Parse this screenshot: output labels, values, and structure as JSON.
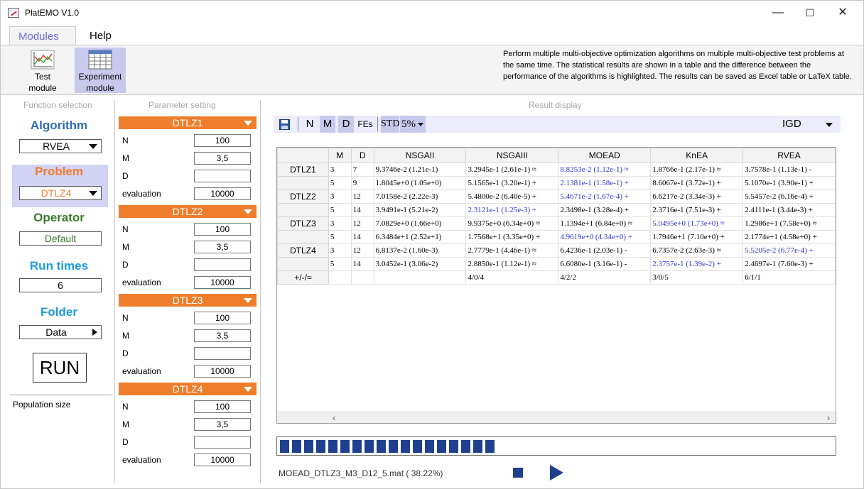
{
  "window": {
    "title": "PlatEMO V1.0",
    "minimize": "—",
    "maximize": "☐",
    "close": "✕"
  },
  "menu": {
    "modules": "Modules",
    "help": "Help"
  },
  "ribbon": {
    "test_module_line1": "Test",
    "test_module_line2": "module",
    "experiment_module_line1": "Experiment",
    "experiment_module_line2": "module",
    "description": "Perform multiple multi-objective optimization algorithms on multiple multi-objective test problems at the same time. The statistical results are shown in a table and the difference between the performance of the algorithms is highlighted. The results can be saved as Excel table or LaTeX table."
  },
  "sections": {
    "function_selection": "Function selection",
    "parameter_setting": "Parameter setting",
    "result_display": "Result display"
  },
  "left": {
    "algorithm_label": "Algorithm",
    "algorithm_value": "RVEA",
    "problem_label": "Problem",
    "problem_value": "DTLZ4",
    "operator_label": "Operator",
    "operator_value": "Default",
    "run_times_label": "Run times",
    "run_times_value": "6",
    "folder_label": "Folder",
    "folder_value": "Data",
    "run_button": "RUN",
    "help_text": "Population size",
    "colors": {
      "algorithm": "#2e6db3",
      "problem": "#ee7d2c",
      "operator": "#3d7a2e",
      "run_times": "#1a9be0",
      "folder": "#1a9be0",
      "highlight": "#d3d3f5"
    }
  },
  "parameters": [
    {
      "problem": "DTLZ1",
      "N": "100",
      "M": "3,5",
      "D": "",
      "evaluation": "10000"
    },
    {
      "problem": "DTLZ2",
      "N": "100",
      "M": "3,5",
      "D": "",
      "evaluation": "10000"
    },
    {
      "problem": "DTLZ3",
      "N": "100",
      "M": "3,5",
      "D": "",
      "evaluation": "10000"
    },
    {
      "problem": "DTLZ4",
      "N": "100",
      "M": "3,5",
      "D": "",
      "evaluation": "10000"
    }
  ],
  "param_labels": {
    "N": "N",
    "M": "M",
    "D": "D",
    "evaluation": "evaluation"
  },
  "toolbar": {
    "save_icon": "save-icon",
    "N": "N",
    "M": "M",
    "D": "D",
    "FEs": "FEs",
    "STD": "STD",
    "significance": "5%",
    "metric": "IGD"
  },
  "table": {
    "headers": [
      "",
      "M",
      "D",
      "NSGAII",
      "NSGAIII",
      "MOEAD",
      "KnEA",
      "RVEA"
    ],
    "rows": [
      {
        "problem": "DTLZ1",
        "M": "3",
        "D": "7",
        "cells": [
          {
            "t": "9.3746e-2 (1.21e-1)",
            "blue": false
          },
          {
            "t": "3.2945e-1 (2.61e-1) ≈",
            "blue": false
          },
          {
            "t": "8.8253e-2 (1.12e-1) ≈",
            "blue": true
          },
          {
            "t": "1.8766e-1 (2.17e-1) ≈",
            "blue": false
          },
          {
            "t": "3.7578e-1 (1.13e-1) -",
            "blue": false
          }
        ]
      },
      {
        "problem": "",
        "M": "5",
        "D": "9",
        "cells": [
          {
            "t": "1.8045e+0 (1.05e+0)",
            "blue": false
          },
          {
            "t": "5.1565e-1 (3.20e-1) +",
            "blue": false
          },
          {
            "t": "2.1381e-1 (1.58e-1) +",
            "blue": true
          },
          {
            "t": "8.6067e-1 (3.72e-1) +",
            "blue": false
          },
          {
            "t": "5.1070e-1 (3.90e-1) +",
            "blue": false
          }
        ]
      },
      {
        "problem": "DTLZ2",
        "M": "3",
        "D": "12",
        "cells": [
          {
            "t": "7.0158e-2 (2.22e-3)",
            "blue": false
          },
          {
            "t": "5.4800e-2 (6.40e-5) +",
            "blue": false
          },
          {
            "t": "5.4671e-2 (1.67e-4) +",
            "blue": true
          },
          {
            "t": "6.6217e-2 (3.34e-3) +",
            "blue": false
          },
          {
            "t": "5.5457e-2 (6.16e-4) +",
            "blue": false
          }
        ]
      },
      {
        "problem": "",
        "M": "5",
        "D": "14",
        "cells": [
          {
            "t": "3.9491e-1 (5.21e-2)",
            "blue": false
          },
          {
            "t": "2.3121e-1 (1.25e-3) +",
            "blue": true
          },
          {
            "t": "2.3498e-1 (3.28e-4) +",
            "blue": false
          },
          {
            "t": "2.3716e-1 (7.51e-3) +",
            "blue": false
          },
          {
            "t": "2.4111e-1 (3.44e-3) +",
            "blue": false
          }
        ]
      },
      {
        "problem": "DTLZ3",
        "M": "3",
        "D": "12",
        "cells": [
          {
            "t": "7.0829e+0 (1.66e+0)",
            "blue": false
          },
          {
            "t": "9.9375e+0 (6.34e+0) ≈",
            "blue": false
          },
          {
            "t": "1.1394e+1 (6.84e+0) ≈",
            "blue": false
          },
          {
            "t": "5.0495e+0 (1.73e+0) ≈",
            "blue": true
          },
          {
            "t": "1.2986e+1 (7.58e+0) ≈",
            "blue": false
          }
        ]
      },
      {
        "problem": "",
        "M": "5",
        "D": "14",
        "cells": [
          {
            "t": "6.3484e+1 (2.52e+1)",
            "blue": false
          },
          {
            "t": "1.7568e+1 (3.35e+0) +",
            "blue": false
          },
          {
            "t": "4.9619e+0 (4.34e+0) +",
            "blue": true
          },
          {
            "t": "1.7946e+1 (7.10e+0) +",
            "blue": false
          },
          {
            "t": "2.1774e+1 (4.58e+0) +",
            "blue": false
          }
        ]
      },
      {
        "problem": "DTLZ4",
        "M": "3",
        "D": "12",
        "cells": [
          {
            "t": "6.8137e-2 (1.60e-3)",
            "blue": false
          },
          {
            "t": "2.7779e-1 (4.46e-1) ≈",
            "blue": false
          },
          {
            "t": "6.4236e-1 (2.03e-1) -",
            "blue": false
          },
          {
            "t": "6.7357e-2 (2.63e-3) ≈",
            "blue": false
          },
          {
            "t": "5.5205e-2 (6.77e-4) +",
            "blue": true
          }
        ]
      },
      {
        "problem": "",
        "M": "5",
        "D": "14",
        "cells": [
          {
            "t": "3.0452e-1 (3.06e-2)",
            "blue": false
          },
          {
            "t": "2.8850e-1 (1.12e-1) ≈",
            "blue": false
          },
          {
            "t": "6.6080e-1 (3.16e-1) -",
            "blue": false
          },
          {
            "t": "2.3757e-1 (1.39e-2) +",
            "blue": true
          },
          {
            "t": "2.4697e-1 (7.60e-3) +",
            "blue": false
          }
        ]
      },
      {
        "problem": "+/-/≈",
        "M": "",
        "D": "",
        "cells": [
          {
            "t": "",
            "blue": false
          },
          {
            "t": "4/0/4",
            "blue": false
          },
          {
            "t": "4/2/2",
            "blue": false
          },
          {
            "t": "3/0/5",
            "blue": false
          },
          {
            "t": "6/1/1",
            "blue": false
          }
        ]
      }
    ]
  },
  "progress": {
    "fraction": 0.38,
    "segments_filled": 18,
    "status": "MOEAD_DTLZ3_M3_D12_5.mat ( 38.22%)"
  }
}
